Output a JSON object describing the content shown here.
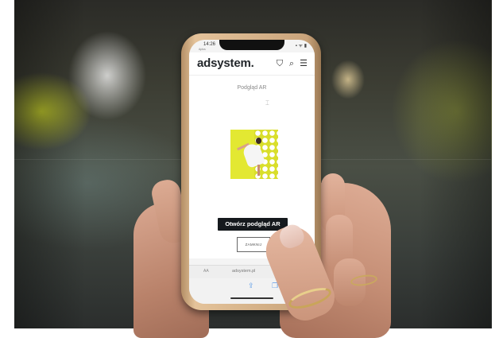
{
  "status_bar": {
    "time": "14:26",
    "carrier": "Aplus",
    "icons": "▪ ᯤ ▮"
  },
  "site_header": {
    "logo": "adsystem.",
    "basket_icon": "⛉",
    "search_icon": "⌕",
    "menu_icon": "☰"
  },
  "content": {
    "title": "Podgląd AR",
    "ar_button_label": "Otwórz podgląd AR",
    "close_button_label": "ZAMKNIJ"
  },
  "url_bar": {
    "aa_label": "AA",
    "url": "adsystem.pl"
  }
}
